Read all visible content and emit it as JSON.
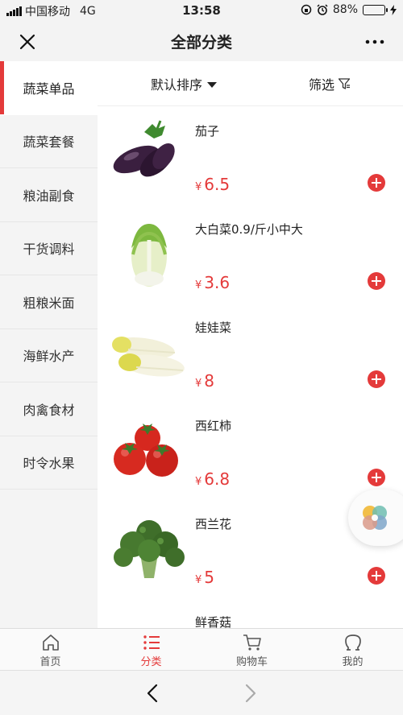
{
  "status_bar": {
    "carrier": "中国移动",
    "network": "4G",
    "time": "13:58",
    "battery": "88%",
    "battery_level": 0.88
  },
  "nav": {
    "title": "全部分类"
  },
  "sidebar": {
    "items": [
      {
        "label": "蔬菜单品"
      },
      {
        "label": "蔬菜套餐"
      },
      {
        "label": "粮油副食"
      },
      {
        "label": "干货调料"
      },
      {
        "label": "粗粮米面"
      },
      {
        "label": "海鲜水产"
      },
      {
        "label": "肉禽食材"
      },
      {
        "label": "时令水果"
      }
    ]
  },
  "filter": {
    "sort_label": "默认排序",
    "filter_label": "筛选"
  },
  "currency_symbol": "¥",
  "products": [
    {
      "name": "茄子",
      "price": "6.5"
    },
    {
      "name": "大白菜0.9/斤小中大",
      "price": "3.6"
    },
    {
      "name": "娃娃菜",
      "price": "8"
    },
    {
      "name": "西红柿",
      "price": "6.8"
    },
    {
      "name": "西兰花",
      "price": "5"
    },
    {
      "name": "鲜香菇"
    }
  ],
  "tabs": [
    {
      "label": "首页",
      "icon": "home-icon"
    },
    {
      "label": "分类",
      "icon": "list-icon"
    },
    {
      "label": "购物车",
      "icon": "cart-icon"
    },
    {
      "label": "我的",
      "icon": "user-icon"
    }
  ],
  "colors": {
    "accent": "#e43a3a",
    "sidebar_bg": "#f4f4f4"
  }
}
